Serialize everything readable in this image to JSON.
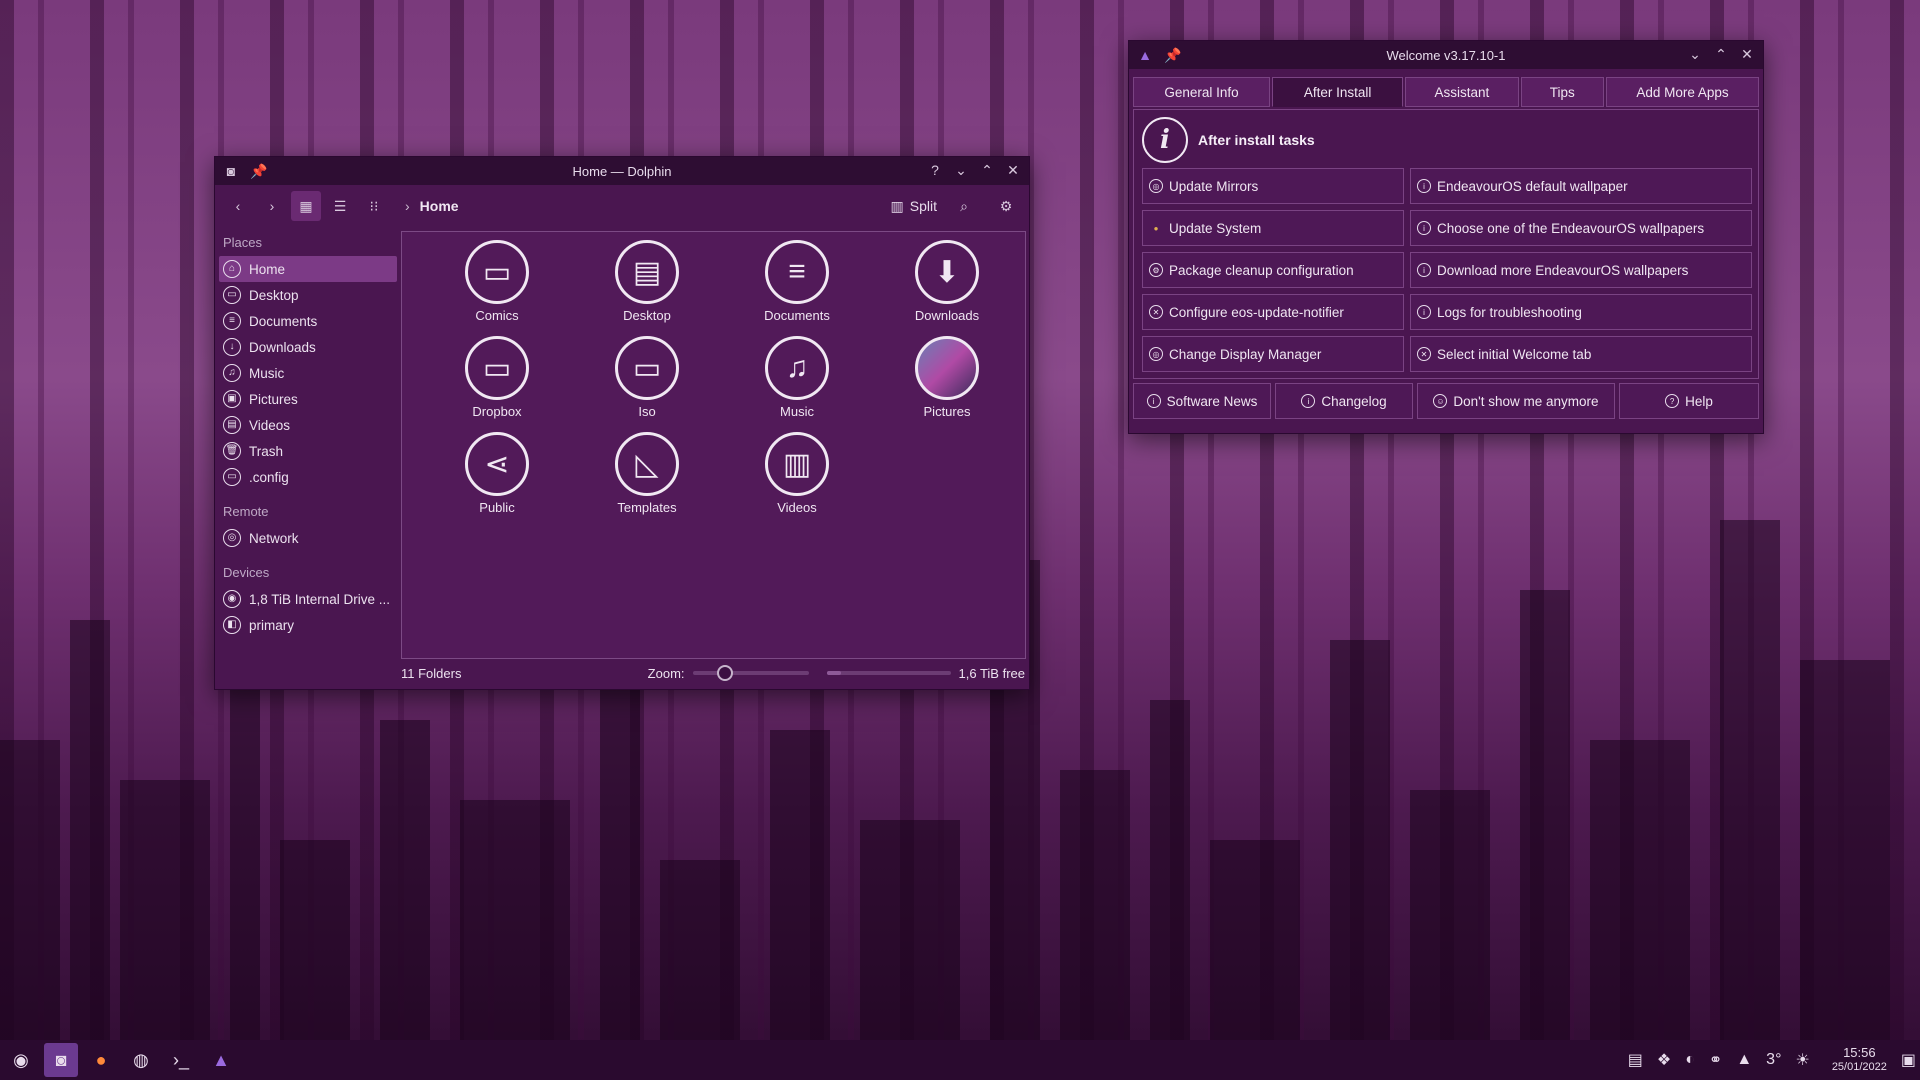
{
  "dolphin": {
    "title": "Home — Dolphin",
    "breadcrumb": "Home",
    "split_label": "Split",
    "places_header": "Places",
    "places": [
      "Home",
      "Desktop",
      "Documents",
      "Downloads",
      "Music",
      "Pictures",
      "Videos",
      "Trash",
      ".config"
    ],
    "remote_header": "Remote",
    "remote": [
      "Network"
    ],
    "devices_header": "Devices",
    "devices": [
      "1,8 TiB Internal Drive ...",
      "primary"
    ],
    "files": [
      "Comics",
      "Desktop",
      "Documents",
      "Downloads",
      "Dropbox",
      "Iso",
      "Music",
      "Pictures",
      "Public",
      "Templates",
      "Videos"
    ],
    "status": "11 Folders",
    "zoom_label": "Zoom:",
    "free_label": "1,6 TiB free",
    "zoom_level": 0.28,
    "used_fraction": 0.12
  },
  "welcome": {
    "title": "Welcome v3.17.10-1",
    "tabs": [
      "General Info",
      "After Install",
      "Assistant",
      "Tips",
      "Add More Apps"
    ],
    "active_tab": "After Install",
    "header": "After install tasks",
    "left_buttons": [
      "Update Mirrors",
      "Update System",
      "Package cleanup configuration",
      "Configure eos-update-notifier",
      "Change Display Manager"
    ],
    "right_buttons": [
      "EndeavourOS default wallpaper",
      "Choose one of the EndeavourOS wallpapers",
      "Download more EndeavourOS wallpapers",
      "Logs for troubleshooting",
      "Select initial Welcome tab"
    ],
    "footer": [
      "Software News",
      "Changelog",
      "Don't show me anymore",
      "Help"
    ]
  },
  "taskbar": {
    "weather": "3°",
    "time": "15:56",
    "date": "25/01/2022"
  },
  "colors": {
    "accent": "#7c3a86",
    "window_bg": "#4a1650",
    "titlebar": "#2e0d33",
    "taskbar": "#2a0a2f"
  }
}
